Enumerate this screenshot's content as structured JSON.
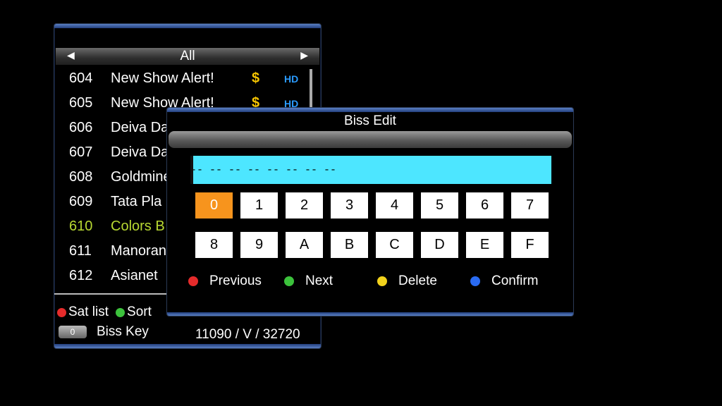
{
  "channel_list": {
    "category": "All",
    "rows": [
      {
        "num": "604",
        "name": "New Show Alert!",
        "dollar": "$",
        "hd": "HD"
      },
      {
        "num": "605",
        "name": "New Show Alert!",
        "dollar": "$",
        "hd": "HD"
      },
      {
        "num": "606",
        "name": "Deiva Da",
        "dollar": "",
        "hd": ""
      },
      {
        "num": "607",
        "name": "Deiva Da",
        "dollar": "",
        "hd": ""
      },
      {
        "num": "608",
        "name": "Goldmine",
        "dollar": "",
        "hd": ""
      },
      {
        "num": "609",
        "name": "Tata Pla",
        "dollar": "",
        "hd": ""
      },
      {
        "num": "610",
        "name": "Colors B",
        "dollar": "",
        "hd": ""
      },
      {
        "num": "611",
        "name": "Manoran",
        "dollar": "",
        "hd": ""
      },
      {
        "num": "612",
        "name": "Asianet",
        "dollar": "",
        "hd": ""
      }
    ],
    "legend": {
      "sat_list": "Sat list",
      "sort": "Sort"
    },
    "biss_key_label": "Biss Key",
    "biss_key_button": "0",
    "frequency": "11090 / V / 32720"
  },
  "biss_dialog": {
    "title": "Biss Edit",
    "input_value": "-- -- -- -- -- -- -- --",
    "keys_row1": [
      "0",
      "1",
      "2",
      "3",
      "4",
      "5",
      "6",
      "7"
    ],
    "keys_row2": [
      "8",
      "9",
      "A",
      "B",
      "C",
      "D",
      "E",
      "F"
    ],
    "actions": {
      "previous": "Previous",
      "next": "Next",
      "delete": "Delete",
      "confirm": "Confirm"
    }
  },
  "colors": {
    "red": "#e52b2b",
    "green": "#3cc23c",
    "yellow": "#f2d21c",
    "blue": "#2a6bf2",
    "input_bg": "#4de6ff",
    "key_active": "#f7941d",
    "selected_row": "#b8d932"
  }
}
